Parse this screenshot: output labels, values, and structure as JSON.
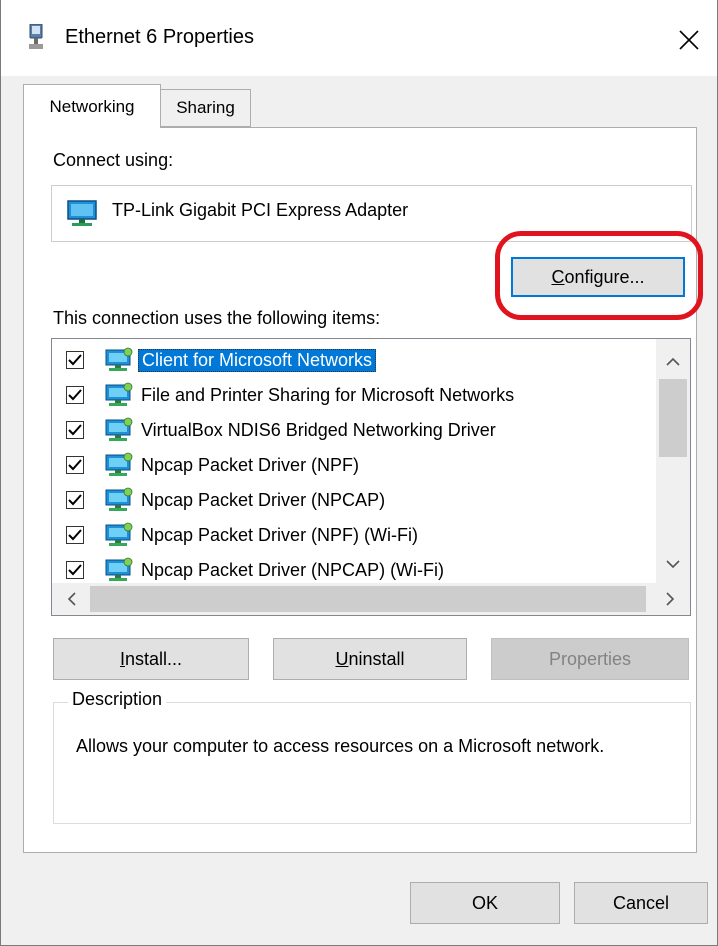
{
  "window": {
    "title": "Ethernet 6 Properties",
    "title_icon": "network-adapter-icon",
    "close_icon": "close-icon"
  },
  "tabs": [
    {
      "label": "Networking",
      "active": true
    },
    {
      "label": "Sharing",
      "active": false
    }
  ],
  "connect_using": {
    "label": "Connect using:",
    "adapter_name": "TP-Link Gigabit PCI Express Adapter",
    "adapter_icon": "network-adapter-icon"
  },
  "configure_button": {
    "label": "Configure...",
    "highlight_color": "#e0141e"
  },
  "items_label": "This connection uses the following items:",
  "items": [
    {
      "label": "Client for Microsoft Networks",
      "checked": true,
      "selected": true,
      "icon": "network-client-icon"
    },
    {
      "label": "File and Printer Sharing for Microsoft Networks",
      "checked": true,
      "selected": false,
      "icon": "network-service-icon"
    },
    {
      "label": "VirtualBox NDIS6 Bridged Networking Driver",
      "checked": true,
      "selected": false,
      "icon": "network-service-icon"
    },
    {
      "label": "Npcap Packet Driver (NPF)",
      "checked": true,
      "selected": false,
      "icon": "network-service-icon"
    },
    {
      "label": "Npcap Packet Driver (NPCAP)",
      "checked": true,
      "selected": false,
      "icon": "network-service-icon"
    },
    {
      "label": "Npcap Packet Driver (NPF) (Wi-Fi)",
      "checked": true,
      "selected": false,
      "icon": "network-service-icon"
    },
    {
      "label": "Npcap Packet Driver (NPCAP) (Wi-Fi)",
      "checked": true,
      "selected": false,
      "icon": "network-service-icon"
    }
  ],
  "buttons": {
    "install": "Install...",
    "uninstall": "Uninstall",
    "properties": "Properties",
    "ok": "OK",
    "cancel": "Cancel"
  },
  "description": {
    "label": "Description",
    "text": "Allows your computer to access resources on a Microsoft network."
  },
  "colors": {
    "selection": "#0078d7",
    "dialog_bg": "#f0f0f0",
    "button_bg": "#e1e1e1"
  }
}
